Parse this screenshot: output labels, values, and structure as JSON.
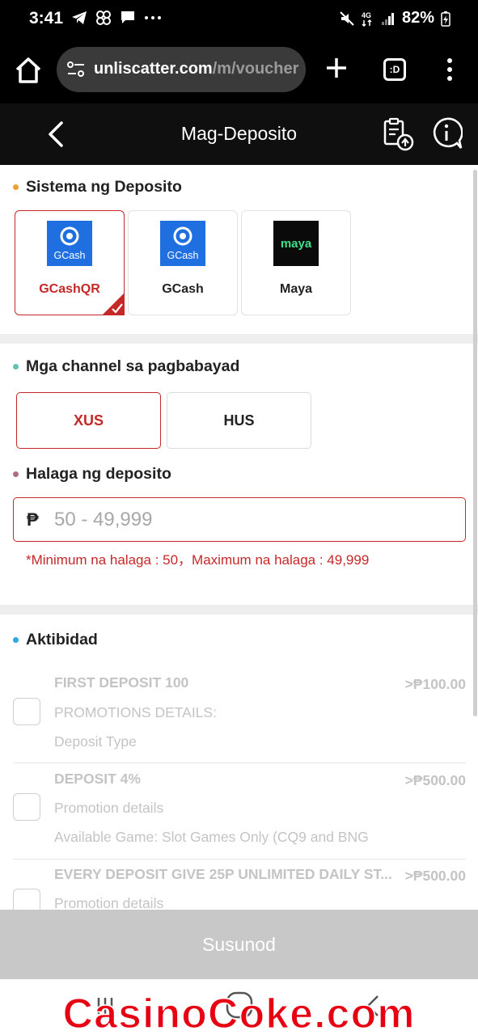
{
  "status_bar": {
    "time": "3:41",
    "battery": "82%",
    "network": "4G"
  },
  "browser": {
    "url_domain": "unliscatter.com",
    "url_path": "/m/voucher",
    "tabs_label": ":D"
  },
  "header": {
    "title": "Mag-Deposito"
  },
  "deposit_system": {
    "title": "Sistema ng Deposito",
    "dot_color": "#f0a030",
    "methods": [
      {
        "label": "GCashQR",
        "logo_text": "GCash",
        "selected": true
      },
      {
        "label": "GCash",
        "logo_text": "GCash",
        "selected": false
      },
      {
        "label": "Maya",
        "logo_text": "maya",
        "selected": false
      }
    ]
  },
  "channels": {
    "title": "Mga channel sa pagbabayad",
    "dot_color": "#5fc4b0",
    "options": [
      {
        "label": "XUS",
        "selected": true
      },
      {
        "label": "HUS",
        "selected": false
      }
    ]
  },
  "amount": {
    "title": "Halaga ng deposito",
    "dot_color": "#b06a8a",
    "currency_symbol": "₱",
    "placeholder": "50 - 49,999",
    "value": "",
    "hint": "*Minimum na halaga : 50，Maximum na halaga : 49,999"
  },
  "activity": {
    "title": "Aktibidad",
    "dot_color": "#2aa8e0",
    "promos": [
      {
        "name": "FIRST DEPOSIT 100",
        "amount": ">₱100.00",
        "line1": "PROMOTIONS DETAILS:",
        "line2": "Deposit Type"
      },
      {
        "name": "DEPOSIT 4%",
        "amount": ">₱500.00",
        "line1": "Promotion details",
        "line2": "Available Game: Slot Games Only (CQ9 and BNG"
      },
      {
        "name": "EVERY DEPOSIT GIVE 25P UNLIMITED DAILY ST...",
        "amount": ">₱500.00",
        "line1": "Promotion details",
        "line2": ""
      }
    ]
  },
  "submit": {
    "label": "Susunod"
  },
  "watermark": {
    "text": "CasinoCoke.com"
  },
  "colors": {
    "accent_red": "#c62828",
    "gcash_blue": "#1f6fe0",
    "maya_green": "#3ee08a"
  }
}
